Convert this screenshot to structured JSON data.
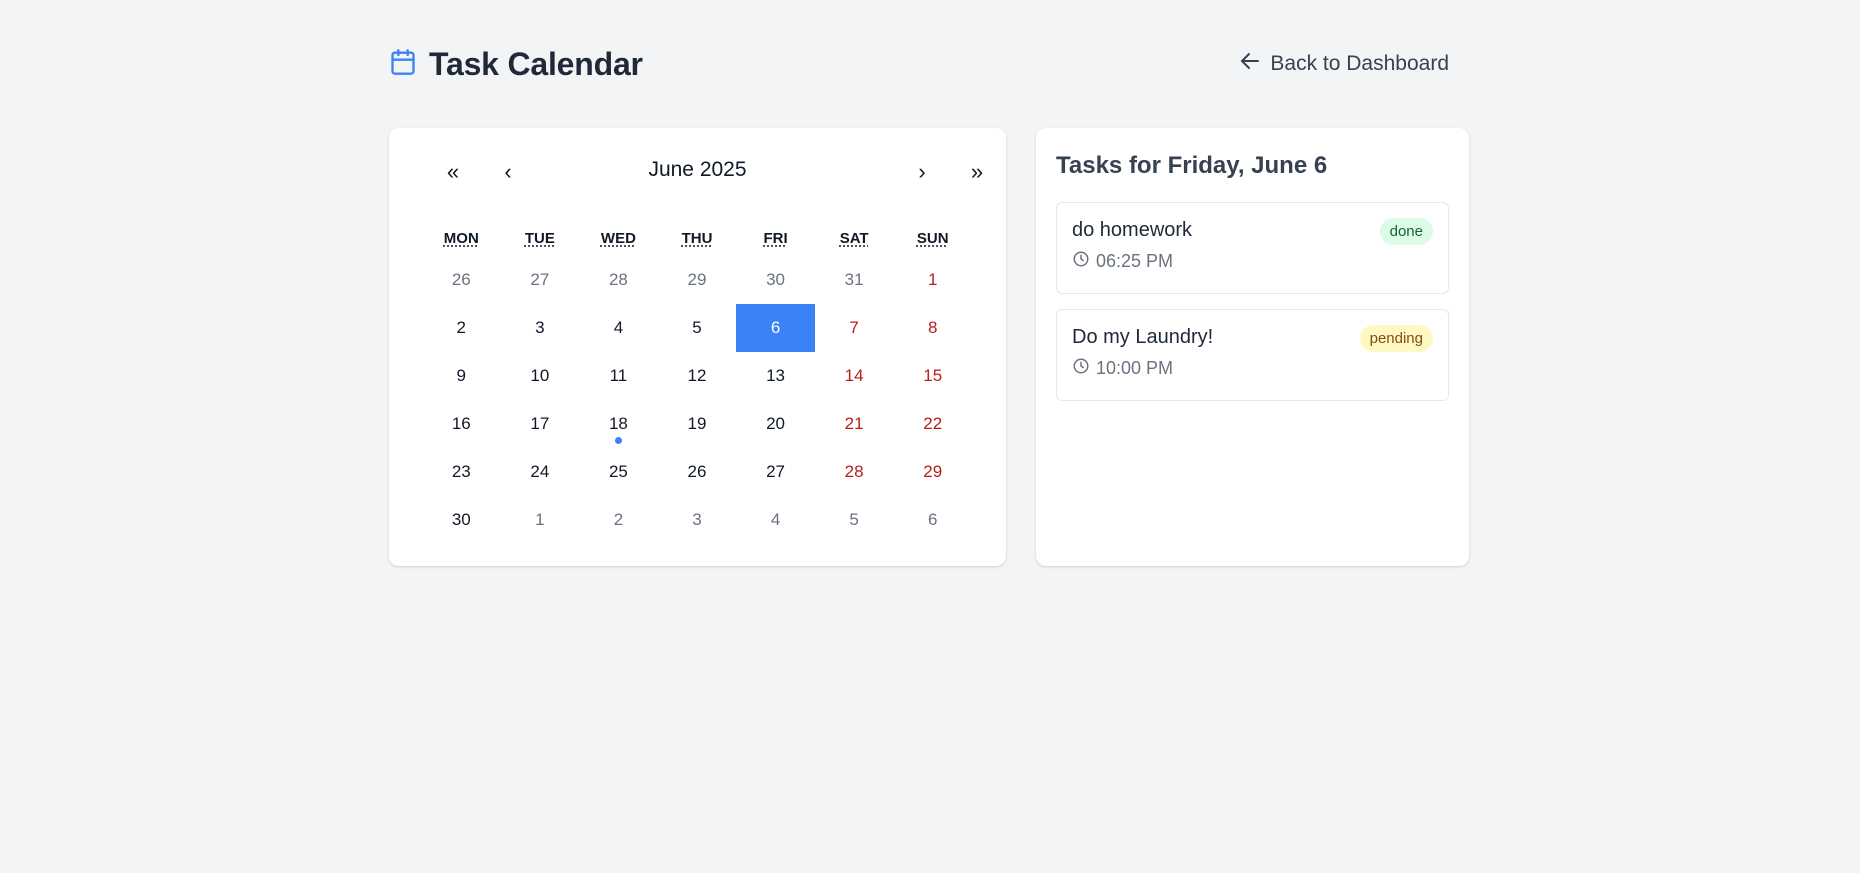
{
  "header": {
    "title": "Task Calendar",
    "back_label": "Back to Dashboard"
  },
  "calendar": {
    "month_label": "June 2025",
    "nav": {
      "prev_year": "«",
      "prev_month": "‹",
      "next_month": "›",
      "next_year": "»"
    },
    "weekdays": [
      "MON",
      "TUE",
      "WED",
      "THU",
      "FRI",
      "SAT",
      "SUN"
    ],
    "weeks": [
      [
        {
          "n": "26",
          "t": "other"
        },
        {
          "n": "27",
          "t": "other"
        },
        {
          "n": "28",
          "t": "other"
        },
        {
          "n": "29",
          "t": "other"
        },
        {
          "n": "30",
          "t": "other"
        },
        {
          "n": "31",
          "t": "other"
        },
        {
          "n": "1",
          "t": "weekend"
        }
      ],
      [
        {
          "n": "2"
        },
        {
          "n": "3"
        },
        {
          "n": "4"
        },
        {
          "n": "5"
        },
        {
          "n": "6",
          "t": "selected"
        },
        {
          "n": "7",
          "t": "weekend"
        },
        {
          "n": "8",
          "t": "weekend"
        }
      ],
      [
        {
          "n": "9"
        },
        {
          "n": "10"
        },
        {
          "n": "11"
        },
        {
          "n": "12"
        },
        {
          "n": "13"
        },
        {
          "n": "14",
          "t": "weekend"
        },
        {
          "n": "15",
          "t": "weekend"
        }
      ],
      [
        {
          "n": "16"
        },
        {
          "n": "17"
        },
        {
          "n": "18",
          "dot": true
        },
        {
          "n": "19"
        },
        {
          "n": "20"
        },
        {
          "n": "21",
          "t": "weekend"
        },
        {
          "n": "22",
          "t": "weekend"
        }
      ],
      [
        {
          "n": "23"
        },
        {
          "n": "24"
        },
        {
          "n": "25"
        },
        {
          "n": "26"
        },
        {
          "n": "27"
        },
        {
          "n": "28",
          "t": "weekend"
        },
        {
          "n": "29",
          "t": "weekend"
        }
      ],
      [
        {
          "n": "30"
        },
        {
          "n": "1",
          "t": "other"
        },
        {
          "n": "2",
          "t": "other"
        },
        {
          "n": "3",
          "t": "other"
        },
        {
          "n": "4",
          "t": "other"
        },
        {
          "n": "5",
          "t": "other"
        },
        {
          "n": "6",
          "t": "other"
        }
      ]
    ]
  },
  "tasks": {
    "title": "Tasks for Friday, June 6",
    "items": [
      {
        "name": "do homework",
        "time": "06:25 PM",
        "status": "done"
      },
      {
        "name": "Do my Laundry!",
        "time": "10:00 PM",
        "status": "pending"
      }
    ]
  },
  "colors": {
    "accent": "#3b82f6",
    "weekend": "#b91c1c",
    "background": "#f3f4f6"
  }
}
